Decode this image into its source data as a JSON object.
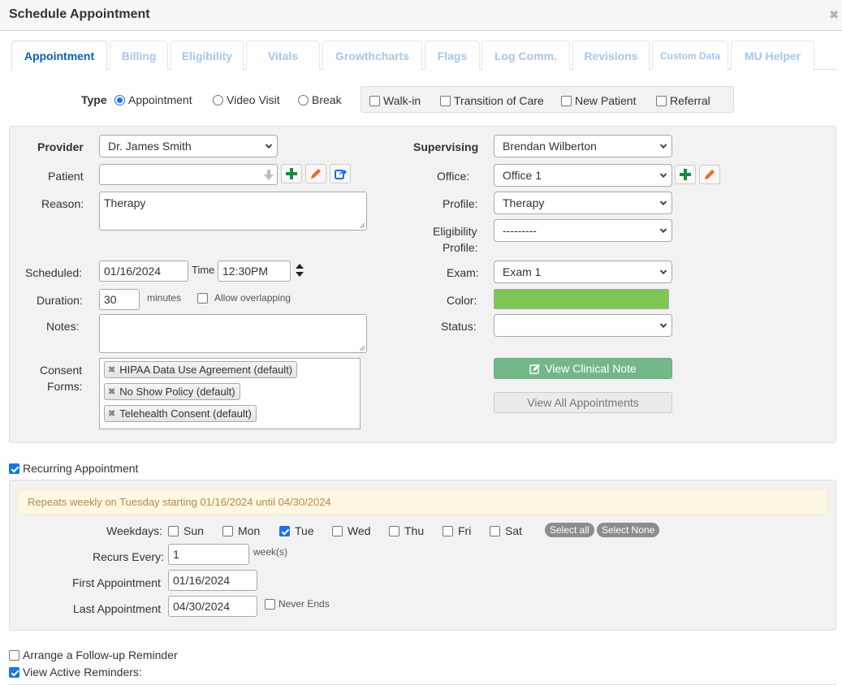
{
  "dialog": {
    "title": "Schedule Appointment",
    "close_icon": "close-x-icon"
  },
  "tabs": [
    {
      "label": "Appointment",
      "active": true
    },
    {
      "label": "Billing",
      "active": false
    },
    {
      "label": "Eligibility",
      "active": false
    },
    {
      "label": "Vitals",
      "active": false
    },
    {
      "label": "Growthcharts",
      "active": false
    },
    {
      "label": "Flags",
      "active": false
    },
    {
      "label": "Log Comm.",
      "active": false
    },
    {
      "label": "Revisions",
      "active": false
    },
    {
      "label": "Custom Data",
      "active": false
    },
    {
      "label": "MU Helper",
      "active": false
    }
  ],
  "type": {
    "label": "Type",
    "options": [
      {
        "label": "Appointment",
        "checked": true
      },
      {
        "label": "Video Visit",
        "checked": false
      },
      {
        "label": "Break",
        "checked": false
      }
    ],
    "flags": [
      {
        "label": "Walk-in",
        "checked": false
      },
      {
        "label": "Transition of Care",
        "checked": false
      },
      {
        "label": "New Patient",
        "checked": false
      },
      {
        "label": "Referral",
        "checked": false
      }
    ]
  },
  "form": {
    "provider": {
      "label": "Provider",
      "value": "Dr. James Smith"
    },
    "patient": {
      "label": "Patient",
      "value": ""
    },
    "reason": {
      "label": "Reason:",
      "value": "Therapy"
    },
    "scheduled": {
      "label": "Scheduled:",
      "date": "01/16/2024",
      "time_label": "Time",
      "time": "12:30PM"
    },
    "duration": {
      "label": "Duration:",
      "value": "30",
      "unit": "minutes",
      "allow_overlapping_label": "Allow overlapping",
      "allow_overlapping": false
    },
    "notes": {
      "label": "Notes:",
      "value": ""
    },
    "consent": {
      "label_line1": "Consent",
      "label_line2": "Forms:",
      "items": [
        "HIPAA Data Use Agreement (default)",
        "No Show Policy (default)",
        "Telehealth Consent (default)"
      ]
    },
    "supervising": {
      "label": "Supervising",
      "value": "Brendan Wilberton"
    },
    "office": {
      "label": "Office:",
      "value": "Office 1"
    },
    "profile": {
      "label": "Profile:",
      "value": "Therapy"
    },
    "eligibility_profile": {
      "label_line1": "Eligibility",
      "label_line2": "Profile:",
      "value": "---------"
    },
    "exam": {
      "label": "Exam:",
      "value": "Exam 1"
    },
    "color": {
      "label": "Color:",
      "value": "#7ec752"
    },
    "status": {
      "label": "Status:",
      "value": ""
    },
    "view_clinical_note": "View Clinical Note",
    "view_all_appointments": "View All Appointments"
  },
  "recurring": {
    "label": "Recurring Appointment",
    "checked": true,
    "summary": "Repeats weekly on Tuesday starting 01/16/2024 until 04/30/2024",
    "weekdays_label": "Weekdays:",
    "days": [
      {
        "label": "Sun",
        "checked": false
      },
      {
        "label": "Mon",
        "checked": false
      },
      {
        "label": "Tue",
        "checked": true
      },
      {
        "label": "Wed",
        "checked": false
      },
      {
        "label": "Thu",
        "checked": false
      },
      {
        "label": "Fri",
        "checked": false
      },
      {
        "label": "Sat",
        "checked": false
      }
    ],
    "select_all": "Select all",
    "select_none": "Select None",
    "recurs_every": {
      "label": "Recurs Every:",
      "value": "1",
      "unit": "week(s)"
    },
    "first": {
      "label": "First Appointment",
      "value": "01/16/2024"
    },
    "last": {
      "label": "Last Appointment",
      "value": "04/30/2024"
    },
    "never_ends": {
      "label": "Never Ends",
      "checked": false
    }
  },
  "reminders": {
    "follow_up": {
      "label": "Arrange a Follow-up Reminder",
      "checked": false
    },
    "view_active": {
      "label": "View Active Reminders:",
      "checked": true
    }
  }
}
